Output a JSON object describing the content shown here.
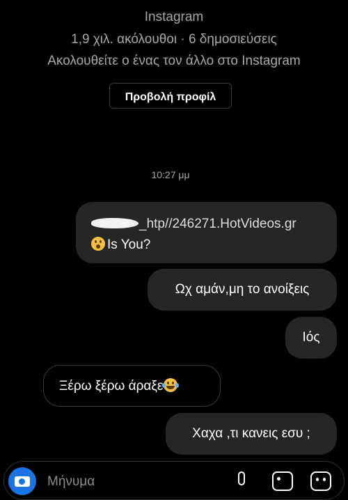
{
  "header": {
    "app_name": "Instagram",
    "stats": "1,9 χιλ. ακόλουθοι · 6 δημοσιεύσεις",
    "mutual": "Ακολουθείτε ο ένας τον άλλο στο Instagram",
    "view_profile_label": "Προβολή προφίλ"
  },
  "timestamp": "10:27 μμ",
  "messages": [
    {
      "sender": "me",
      "line1_link": "_htp//246271.HotVideos.gr",
      "line2_text": "Is You?",
      "emoji": "astonished-face-emoji"
    },
    {
      "sender": "me",
      "text": "Ωχ αμάν,μη το ανοίξεις"
    },
    {
      "sender": "me",
      "text": "Ιός"
    },
    {
      "sender": "other",
      "text": "Ξέρω ξέρω άραξε",
      "emoji": "tears-of-joy-emoji"
    },
    {
      "sender": "me",
      "text": "Χαχα ,τι κανεις εσυ ;"
    }
  ],
  "composer": {
    "placeholder": "Μήνυμα",
    "icons": [
      "camera-icon",
      "microphone-icon",
      "gallery-icon",
      "sticker-icon"
    ]
  },
  "colors": {
    "background": "#000000",
    "bubble": "#262626",
    "secondary_text": "#a8a8a8",
    "accent": "#1b74e4"
  }
}
